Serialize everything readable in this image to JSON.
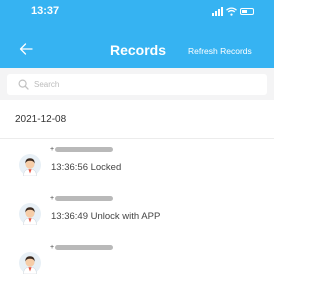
{
  "status_bar": {
    "time": "13:37"
  },
  "nav": {
    "title": "Records",
    "refresh_label": "Refresh Records"
  },
  "search": {
    "placeholder": "Search"
  },
  "date_header": "2021-12-08",
  "records": [
    {
      "user_prefix": "+",
      "event": "13:36:56 Locked"
    },
    {
      "user_prefix": "+",
      "event": "13:36:49 Unlock with APP"
    },
    {
      "user_prefix": "+",
      "event": ""
    }
  ],
  "colors": {
    "header": "#36b3f2",
    "search_bg": "#f4f4f5",
    "background": "#ffffff"
  },
  "icons": [
    "signal-icon",
    "wifi-icon",
    "battery-icon",
    "back-arrow-icon",
    "search-icon",
    "avatar-icon"
  ]
}
